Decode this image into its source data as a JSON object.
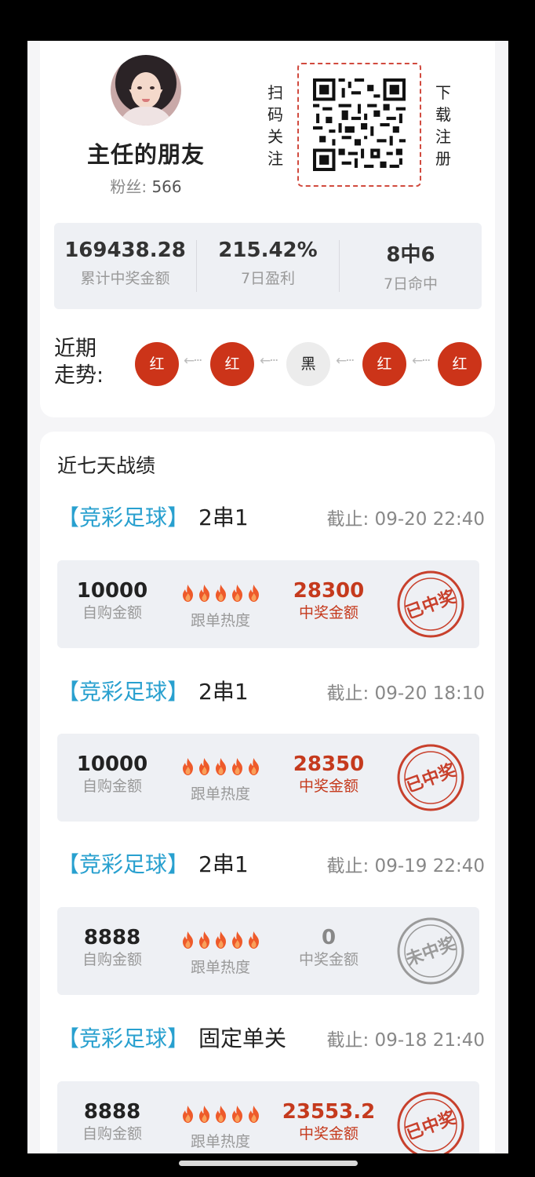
{
  "profile": {
    "username": "主任的朋友",
    "fans_label": "粉丝:",
    "fans_count": "566",
    "scan_label": [
      "扫",
      "码",
      "关",
      "注"
    ],
    "download_label": [
      "下",
      "载",
      "注",
      "册"
    ]
  },
  "stats": [
    {
      "value": "169438.28",
      "label": "累计中奖金额"
    },
    {
      "value": "215.42%",
      "label": "7日盈利"
    },
    {
      "value": "8中6",
      "label": "7日命中"
    }
  ],
  "trend": {
    "label_line1": "近期",
    "label_line2": "走势:",
    "balls": [
      "红",
      "红",
      "黑",
      "红",
      "红"
    ]
  },
  "records": {
    "title": "近七天战绩",
    "items": [
      {
        "type": "【竞彩足球】",
        "play": "2串1",
        "deadline": "截止: 09-20 22:40",
        "buy_amount": "10000",
        "buy_label": "自购金额",
        "heat_label": "跟单热度",
        "win_amount": "28300",
        "win_label": "中奖金额",
        "status": "已中奖"
      },
      {
        "type": "【竞彩足球】",
        "play": "2串1",
        "deadline": "截止: 09-20 18:10",
        "buy_amount": "10000",
        "buy_label": "自购金额",
        "heat_label": "跟单热度",
        "win_amount": "28350",
        "win_label": "中奖金额",
        "status": "已中奖"
      },
      {
        "type": "【竞彩足球】",
        "play": "2串1",
        "deadline": "截止: 09-19 22:40",
        "buy_amount": "8888",
        "buy_label": "自购金额",
        "heat_label": "跟单热度",
        "win_amount": "0",
        "win_label": "中奖金额",
        "status": "未中奖"
      },
      {
        "type": "【竞彩足球】",
        "play": "固定单关",
        "deadline": "截止: 09-18 21:40",
        "buy_amount": "8888",
        "buy_label": "自购金额",
        "heat_label": "跟单热度",
        "win_amount": "23553.2",
        "win_label": "中奖金额",
        "status": "已中奖"
      }
    ]
  },
  "colors": {
    "red": "#cc3419",
    "accent_blue": "#28a0cf",
    "win_red": "#c53a1d",
    "stamp_grey": "#9a9a9a"
  }
}
